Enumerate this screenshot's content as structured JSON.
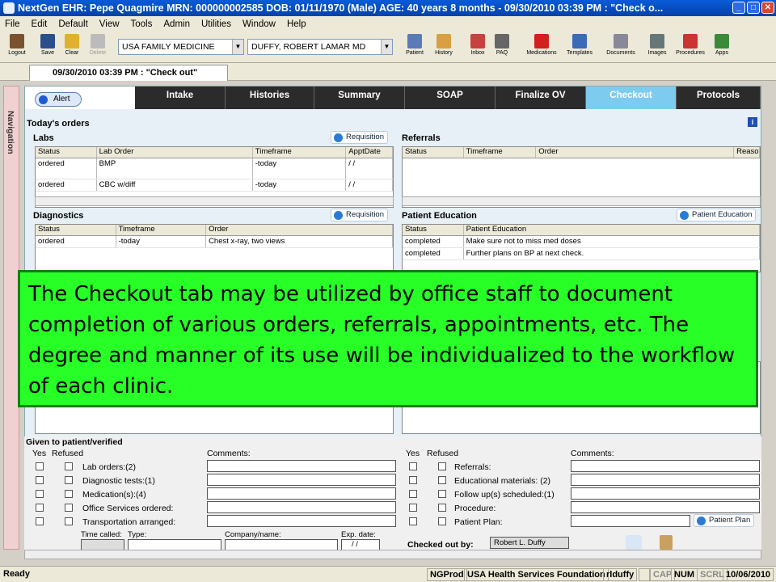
{
  "window": {
    "title": "NextGen EHR: Pepe Quagmire  MRN: 000000002585  DOB: 01/11/1970  (Male)  AGE: 40 years 8 months - 09/30/2010 03:39 PM : \"Check o..."
  },
  "menu": [
    "File",
    "Edit",
    "Default",
    "View",
    "Tools",
    "Admin",
    "Utilities",
    "Window",
    "Help"
  ],
  "toolbar": {
    "left_buttons": [
      "Logout",
      "Save",
      "Clear",
      "Delete"
    ],
    "practice": "USA FAMILY MEDICINE",
    "provider": "DUFFY, ROBERT  LAMAR MD",
    "right_buttons": [
      "Patient",
      "History",
      "Inbox",
      "PAQ",
      "Medications",
      "Templates",
      "Documents",
      "Images",
      "Procedures",
      "Apps"
    ]
  },
  "document_tab": "09/30/2010 03:39 PM : \"Check out\"",
  "navigation_label": "Navigation",
  "alert_label": "Alert",
  "workflow_tabs": [
    "Intake",
    "Histories",
    "Summary",
    "SOAP",
    "Finalize OV",
    "Checkout",
    "Protocols"
  ],
  "active_tab": "Checkout",
  "todays_orders": "Today's orders",
  "labs": {
    "title": "Labs",
    "button": "Requisition",
    "columns": [
      "Status",
      "Lab Order",
      "Timeframe",
      "ApptDate"
    ],
    "rows": [
      [
        "ordered",
        "BMP",
        "-today",
        " /  /"
      ],
      [
        "ordered",
        "CBC w/diff",
        "-today",
        " /  /"
      ]
    ]
  },
  "referrals": {
    "title": "Referrals",
    "columns": [
      "Status",
      "Timeframe",
      "Order",
      "Reaso"
    ]
  },
  "diagnostics": {
    "title": "Diagnostics",
    "button": "Requisition",
    "columns": [
      "Status",
      "Timeframe",
      "Order"
    ],
    "rows": [
      [
        "ordered",
        "-today",
        "Chest x-ray, two views"
      ]
    ]
  },
  "patient_education": {
    "title": "Patient Education",
    "button": "Patient Education",
    "columns": [
      "Status",
      "Patient Education"
    ],
    "rows": [
      [
        "completed",
        "Make sure not to miss med doses"
      ],
      [
        "completed",
        "Further plans on BP at next check."
      ]
    ]
  },
  "overlay_text": "The Checkout tab may be utilized by office staff to document completion of various orders, referrals, appointments, etc.  The degree and manner of its use will be individualized to the workflow of each clinic.",
  "given": {
    "title": "Given to patient/verified",
    "yes": "Yes",
    "refused": "Refused",
    "comments": "Comments:",
    "left_items": [
      "Lab orders:(2)",
      "Diagnostic tests:(1)",
      "Medication(s):(4)",
      "Office Services ordered:",
      "Transportation arranged:"
    ],
    "right_items": [
      "Referrals:",
      "Educational materials:  (2)",
      "Follow up(s) scheduled:(1)",
      "Procedure:",
      "Patient Plan:"
    ],
    "patient_plan_button": "Patient Plan",
    "time_called": "Time called:",
    "type": "Type:",
    "company": "Company/name:",
    "exp_date": "Exp. date:",
    "exp_value": " /  /",
    "checked_out_by_label": "Checked out by:",
    "checked_out_by": "Robert L. Duffy"
  },
  "status": {
    "left": "Ready",
    "panels": [
      "NGProd",
      "USA Health Services Foundation",
      "rlduffy",
      "",
      "CAP",
      "NUM",
      "SCRL",
      "10/06/2010"
    ]
  }
}
